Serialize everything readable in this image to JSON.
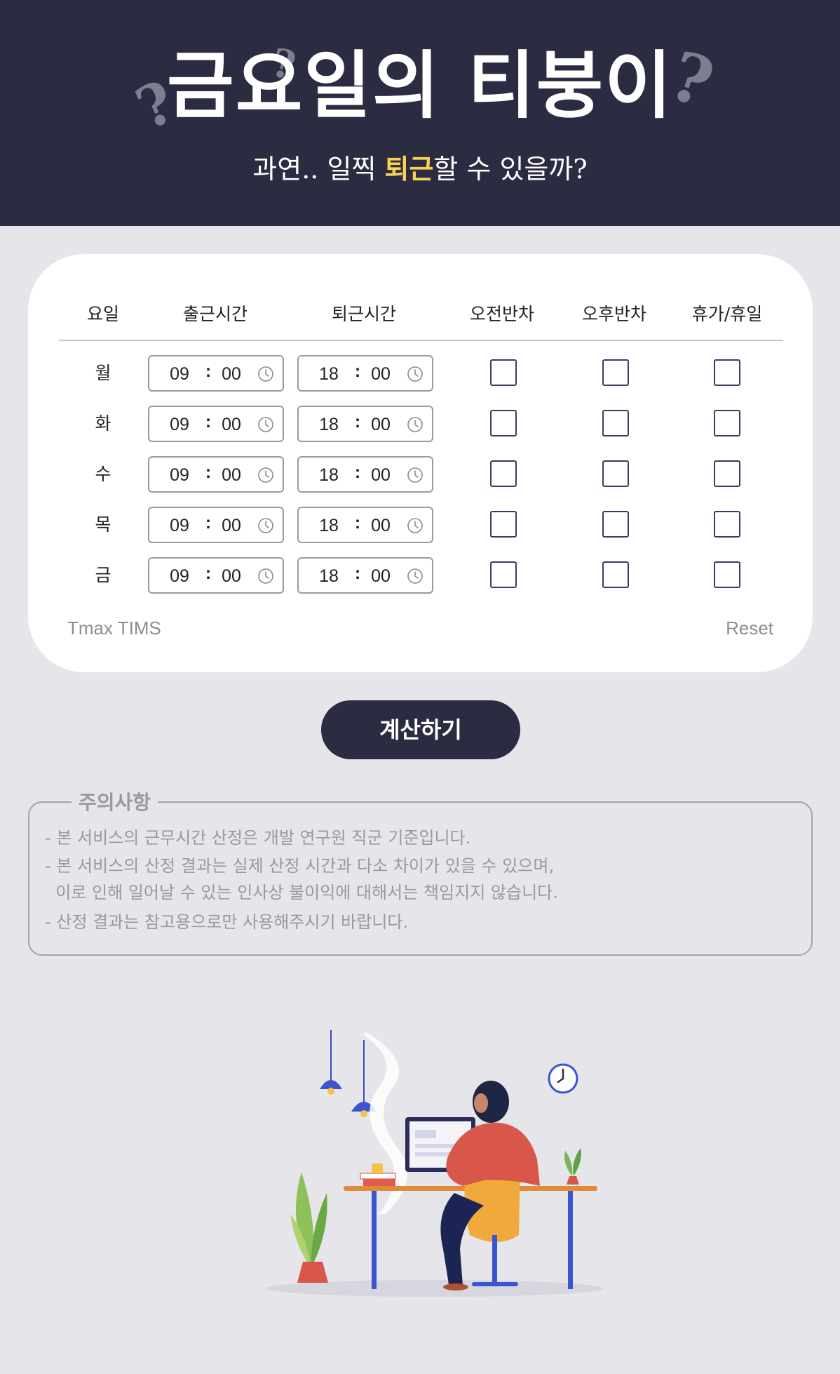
{
  "header": {
    "title": "금요일의 티붕이",
    "question_mark": "?",
    "subtitle_pre": "과연.. 일찍 ",
    "subtitle_highlight": "퇴근",
    "subtitle_post": "할 수 있을까?"
  },
  "table": {
    "headers": [
      "요일",
      "출근시간",
      "퇴근시간",
      "오전반차",
      "오후반차",
      "휴가/휴일"
    ],
    "time_separator": ":",
    "rows": [
      {
        "day": "월",
        "start_h": "09",
        "start_m": "00",
        "end_h": "18",
        "end_m": "00",
        "am_half": false,
        "pm_half": false,
        "vacation": false
      },
      {
        "day": "화",
        "start_h": "09",
        "start_m": "00",
        "end_h": "18",
        "end_m": "00",
        "am_half": false,
        "pm_half": false,
        "vacation": false
      },
      {
        "day": "수",
        "start_h": "09",
        "start_m": "00",
        "end_h": "18",
        "end_m": "00",
        "am_half": false,
        "pm_half": false,
        "vacation": false
      },
      {
        "day": "목",
        "start_h": "09",
        "start_m": "00",
        "end_h": "18",
        "end_m": "00",
        "am_half": false,
        "pm_half": false,
        "vacation": false
      },
      {
        "day": "금",
        "start_h": "09",
        "start_m": "00",
        "end_h": "18",
        "end_m": "00",
        "am_half": false,
        "pm_half": false,
        "vacation": false
      }
    ]
  },
  "card_footer": {
    "brand": "Tmax TIMS",
    "reset": "Reset"
  },
  "calculate_button": "계산하기",
  "notice": {
    "title": "주의사항",
    "lines": [
      "- 본 서비스의 근무시간 산정은 개발 연구원 직군 기준입니다.",
      "- 본 서비스의 산정 결과는 실제 산정 시간과 다소 차이가 있을 수 있으며,",
      "  이로 인해 일어날 수 있는 인사상 불이익에 대해서는 책임지지 않습니다.",
      "- 산정 결과는 참고용으로만 사용해주시기 바랍니다."
    ]
  },
  "colors": {
    "header_bg": "#2b2b42",
    "highlight": "#f7d154",
    "page_bg": "#e5e5ea",
    "checkbox_border": "#3b3b66"
  },
  "icons": {
    "time_input": "clock-icon",
    "illustration": "person-working-at-desk-illustration"
  }
}
